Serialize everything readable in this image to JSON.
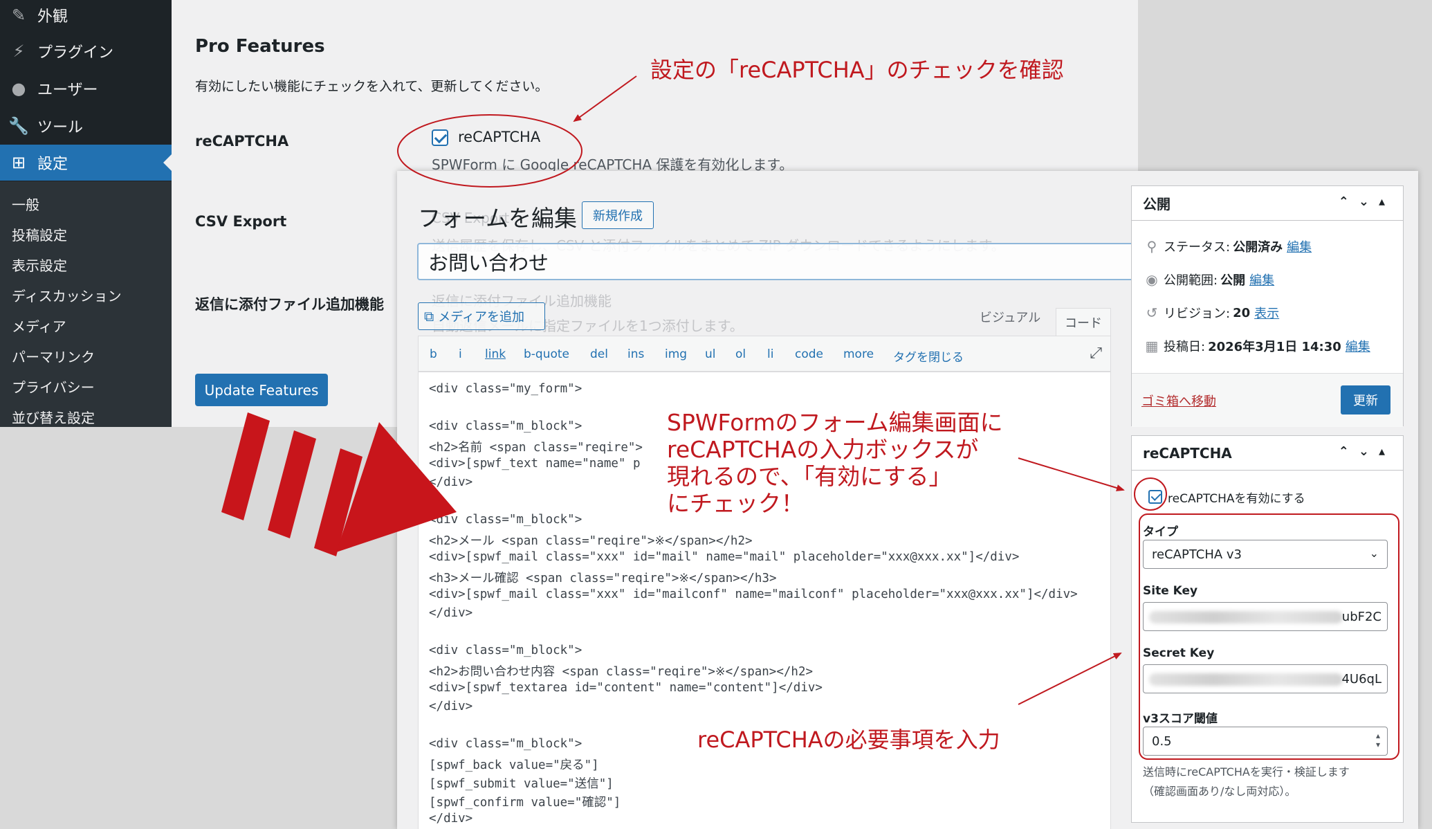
{
  "sidebar": {
    "items": [
      {
        "label": "外観",
        "icon": "brush-icon"
      },
      {
        "label": "プラグイン",
        "icon": "plugin-icon"
      },
      {
        "label": "ユーザー",
        "icon": "user-icon"
      },
      {
        "label": "ツール",
        "icon": "wrench-icon"
      },
      {
        "label": "設定",
        "icon": "settings-icon",
        "active": true
      }
    ],
    "submenu": [
      "一般",
      "投稿設定",
      "表示設定",
      "ディスカッション",
      "メディア",
      "パーマリンク",
      "プライバシー",
      "並び替え設定"
    ]
  },
  "pro": {
    "title": "Pro Features",
    "description": "有効にしたい機能にチェックを入れて、更新してください。",
    "features": [
      {
        "label": "reCAPTCHA",
        "check_label": "reCAPTCHA",
        "checked": true,
        "description": "SPWForm に Google reCAPTCHA 保護を有効化します。"
      },
      {
        "label": "CSV Export",
        "check_label": "CSV Export",
        "description": "送信履歴を保存し、CSV と添付ファイルをまとめて ZIP ダウンロードできるようにします。"
      },
      {
        "label": "返信に添付ファイル追加機能",
        "check_label": "返信に添付ファイル追加機能",
        "description": "自動返信メールに指定ファイルを1つ添付します。"
      }
    ],
    "update_button": "Update Features"
  },
  "editor": {
    "heading": "フォームを編集",
    "new_button": "新規作成",
    "form_title": "お問い合わせ",
    "media_button": "メディアを追加",
    "tab_visual": "ビジュアル",
    "tab_code": "コード",
    "quicktags": [
      "b",
      "i",
      "link",
      "b-quote",
      "del",
      "ins",
      "img",
      "ul",
      "ol",
      "li",
      "code",
      "more",
      "タグを閉じる"
    ],
    "code_lines": [
      "<div class=\"my_form\">",
      "",
      "<div class=\"m_block\">",
      "<h2>名前 <span class=\"reqire\">",
      "<div>[spwf_text name=\"name\" p",
      "</div>",
      "",
      "<div class=\"m_block\">",
      "<h2>メール <span class=\"reqire\">※</span></h2>",
      "<div>[spwf_mail class=\"xxx\" id=\"mail\" name=\"mail\" placeholder=\"xxx@xxx.xx\"]</div>",
      "<h3>メール確認 <span class=\"reqire\">※</span></h3>",
      "<div>[spwf_mail class=\"xxx\" id=\"mailconf\" name=\"mailconf\" placeholder=\"xxx@xxx.xx\"]</div>",
      "</div>",
      "",
      "<div class=\"m_block\">",
      "<h2>お問い合わせ内容 <span class=\"reqire\">※</span></h2>",
      "<div>[spwf_textarea id=\"content\" name=\"content\"]</div>",
      "</div>",
      "",
      "<div class=\"m_block\">",
      "[spwf_back value=\"戻る\"]",
      "[spwf_submit value=\"送信\"]",
      "[spwf_confirm value=\"確認\"]",
      "</div>"
    ]
  },
  "publish": {
    "title": "公開",
    "status_label": "ステータス:",
    "status_value": "公開済み",
    "visibility_label": "公開範囲:",
    "visibility_value": "公開",
    "revision_label": "リビジョン:",
    "revision_value": "20",
    "revision_link": "表示",
    "date_label": "投稿日:",
    "date_value": "2026年3月1日 14:30",
    "edit_link": "編集",
    "trash": "ゴミ箱へ移動",
    "update": "更新"
  },
  "recaptcha_box": {
    "title": "reCAPTCHA",
    "enable_label": "reCAPTCHAを有効にする",
    "enabled": true,
    "type_label": "タイプ",
    "type_value": "reCAPTCHA v3",
    "site_key_label": "Site Key",
    "site_key_tail": "ubF2C",
    "secret_key_label": "Secret Key",
    "secret_key_tail": "4U6qL",
    "threshold_label": "v3スコア閾値",
    "threshold_value": "0.5",
    "help_line1": "送信時にreCAPTCHAを実行・検証します",
    "help_line2": "（確認画面あり/なし両対応）。"
  },
  "annotations": {
    "top": "設定の「reCAPTCHA」のチェックを確認",
    "middle": [
      "SPWFormのフォーム編集画面に",
      "reCAPTCHAの入力ボックスが",
      "現れるので、「有効にする」",
      "にチェック！"
    ],
    "bottom": "reCAPTCHAの必要事項を入力",
    "color": "#c0191f"
  }
}
